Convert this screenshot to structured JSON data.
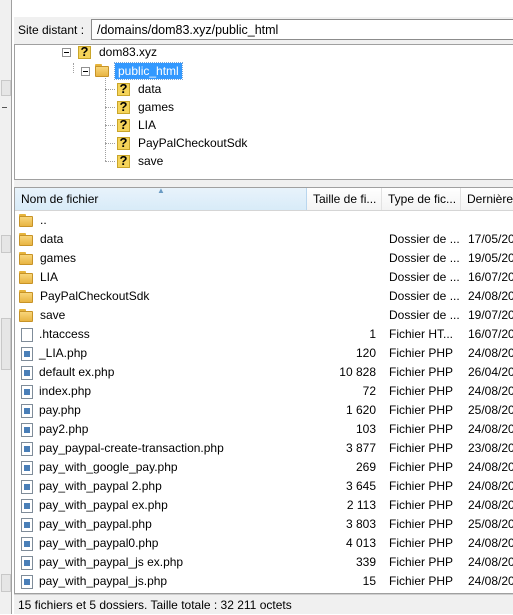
{
  "address_bar": {
    "label": "Site distant :",
    "path": "/domains/dom83.xyz/public_html"
  },
  "tree": {
    "root": {
      "label": "dom83.xyz",
      "icon": "unknown-folder-icon"
    },
    "current": {
      "label": "public_html",
      "icon": "folder-icon",
      "selected": true
    },
    "children": [
      {
        "label": "data",
        "icon": "unknown-folder-icon"
      },
      {
        "label": "games",
        "icon": "unknown-folder-icon"
      },
      {
        "label": "LIA",
        "icon": "unknown-folder-icon"
      },
      {
        "label": "PayPalCheckoutSdk",
        "icon": "unknown-folder-icon"
      },
      {
        "label": "save",
        "icon": "unknown-folder-icon"
      }
    ]
  },
  "columns": {
    "name": "Nom de fichier",
    "size": "Taille de fi...",
    "type": "Type de fic...",
    "date": "Dernière"
  },
  "files": [
    {
      "name": "..",
      "size": "",
      "type": "",
      "date": "",
      "kind": "folder"
    },
    {
      "name": "data",
      "size": "",
      "type": "Dossier de ...",
      "date": "17/05/20",
      "kind": "folder"
    },
    {
      "name": "games",
      "size": "",
      "type": "Dossier de ...",
      "date": "19/05/20",
      "kind": "folder"
    },
    {
      "name": "LIA",
      "size": "",
      "type": "Dossier de ...",
      "date": "16/07/20",
      "kind": "folder"
    },
    {
      "name": "PayPalCheckoutSdk",
      "size": "",
      "type": "Dossier de ...",
      "date": "24/08/20",
      "kind": "folder"
    },
    {
      "name": "save",
      "size": "",
      "type": "Dossier de ...",
      "date": "19/07/20",
      "kind": "folder"
    },
    {
      "name": ".htaccess",
      "size": "1",
      "type": "Fichier HT...",
      "date": "16/07/20",
      "kind": "plain"
    },
    {
      "name": "_LIA.php",
      "size": "120",
      "type": "Fichier PHP",
      "date": "24/08/20",
      "kind": "php"
    },
    {
      "name": "default ex.php",
      "size": "10 828",
      "type": "Fichier PHP",
      "date": "26/04/20",
      "kind": "php"
    },
    {
      "name": "index.php",
      "size": "72",
      "type": "Fichier PHP",
      "date": "24/08/20",
      "kind": "php"
    },
    {
      "name": "pay.php",
      "size": "1 620",
      "type": "Fichier PHP",
      "date": "25/08/20",
      "kind": "php"
    },
    {
      "name": "pay2.php",
      "size": "103",
      "type": "Fichier PHP",
      "date": "24/08/20",
      "kind": "php"
    },
    {
      "name": "pay_paypal-create-transaction.php",
      "size": "3 877",
      "type": "Fichier PHP",
      "date": "23/08/20",
      "kind": "php"
    },
    {
      "name": "pay_with_google_pay.php",
      "size": "269",
      "type": "Fichier PHP",
      "date": "24/08/20",
      "kind": "php"
    },
    {
      "name": "pay_with_paypal 2.php",
      "size": "3 645",
      "type": "Fichier PHP",
      "date": "24/08/20",
      "kind": "php"
    },
    {
      "name": "pay_with_paypal ex.php",
      "size": "2 113",
      "type": "Fichier PHP",
      "date": "24/08/20",
      "kind": "php"
    },
    {
      "name": "pay_with_paypal.php",
      "size": "3 803",
      "type": "Fichier PHP",
      "date": "25/08/20",
      "kind": "php"
    },
    {
      "name": "pay_with_paypal0.php",
      "size": "4 013",
      "type": "Fichier PHP",
      "date": "24/08/20",
      "kind": "php"
    },
    {
      "name": "pay_with_paypal_js ex.php",
      "size": "339",
      "type": "Fichier PHP",
      "date": "24/08/20",
      "kind": "php"
    },
    {
      "name": "pay_with_paypal_js.php",
      "size": "15",
      "type": "Fichier PHP",
      "date": "24/08/20",
      "kind": "php"
    }
  ],
  "status": "15 fichiers et 5 dossiers. Taille totale : 32 211 octets",
  "colors": {
    "selection": "#3399ff",
    "folder": "#f0c35a",
    "panel": "#f0f0f0"
  }
}
